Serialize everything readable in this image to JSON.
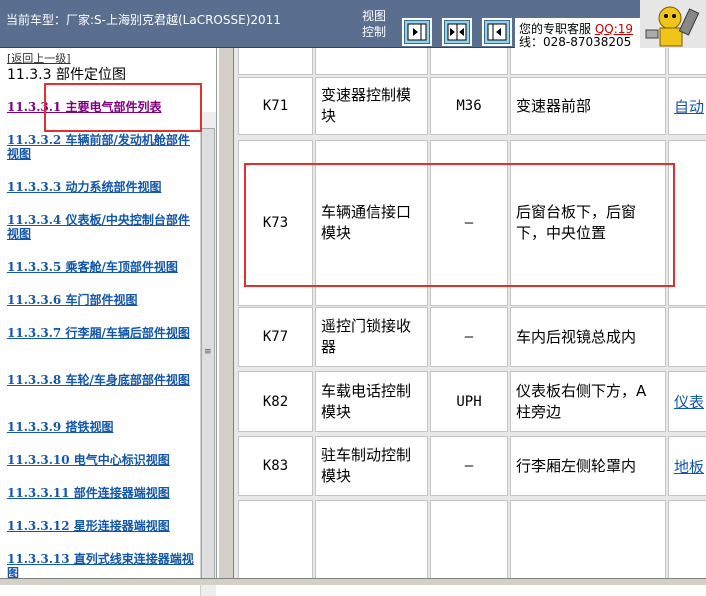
{
  "header": {
    "car_label": "当前车型：厂家:S-上海别克君越(LaCROSSE)2011",
    "view_label": "视图控制",
    "service_label": "您的专职客服",
    "qq_label": "QQ:19",
    "phone_label": "线：028-87038205",
    "view_buttons": [
      "show-right-icon",
      "split-icon",
      "show-left-icon"
    ]
  },
  "sidebar": {
    "back_link": "[返回上一级]",
    "section_title": "11.3.3 部件定位图",
    "items": [
      {
        "label": "11.3.3.1 主要电气部件列表",
        "active": true
      },
      {
        "label": "11.3.3.2 车辆前部/发动机舱部件视图"
      },
      {
        "label": "11.3.3.3 动力系统部件视图"
      },
      {
        "label": "11.3.3.4 仪表板/中央控制台部件视图"
      },
      {
        "label": "11.3.3.5 乘客舱/车顶部件视图"
      },
      {
        "label": "11.3.3.6 车门部件视图"
      },
      {
        "label": "11.3.3.7 行李厢/车辆后部件视图"
      },
      {
        "label": "11.3.3.8 车轮/车身底部部件视图"
      },
      {
        "label": "11.3.3.9 搭铁视图"
      },
      {
        "label": "11.3.3.10 电气中心标识视图"
      },
      {
        "label": "11.3.3.11 部件连接器端视图"
      },
      {
        "label": "11.3.3.12 星形连接器端视图"
      },
      {
        "label": "11.3.3.13 直列式线束连接器端视图"
      }
    ]
  },
  "table": {
    "rows": [
      {
        "id": "",
        "name": "",
        "connector": "",
        "location": "",
        "link": ""
      },
      {
        "id": "K71",
        "name": "变速器控制模块",
        "connector": "M36",
        "location": "变速器前部",
        "link": "自动"
      },
      {
        "id": "K73",
        "name": "车辆通信接口模块",
        "connector": "—",
        "location": "后窗台板下，后窗下，中央位置",
        "link": ""
      },
      {
        "id": "K77",
        "name": "遥控门锁接收器",
        "connector": "—",
        "location": "车内后视镜总成内",
        "link": ""
      },
      {
        "id": "K82",
        "name": "车载电话控制模块",
        "connector": "UPH",
        "location": "仪表板右侧下方，A柱旁边",
        "link": "仪表"
      },
      {
        "id": "K83",
        "name": "驻车制动控制模块",
        "connector": "—",
        "location": "行李厢左侧轮罩内",
        "link": "地板"
      },
      {
        "id": "",
        "name": "",
        "connector": "",
        "location": "",
        "link": ""
      }
    ]
  },
  "colors": {
    "header_bg": "#5a6f8f",
    "link": "#1357a8",
    "visited": "#800080",
    "highlight_box": "#e03030"
  }
}
